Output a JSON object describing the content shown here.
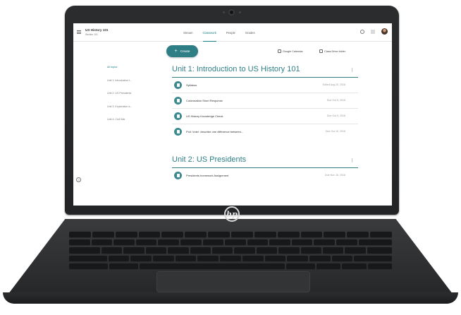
{
  "header": {
    "class_title": "US History 101",
    "class_subtitle": "Section 101",
    "tabs": [
      {
        "label": "Stream"
      },
      {
        "label": "Classwork",
        "active": true
      },
      {
        "label": "People"
      },
      {
        "label": "Grades"
      }
    ]
  },
  "toolbar": {
    "create_label": "Create",
    "calendar_label": "Google Calendar",
    "drive_label": "Class Drive folder"
  },
  "sidebar": {
    "items": [
      {
        "label": "All topics",
        "active": true
      },
      {
        "label": "Unit 1: Introduction t..."
      },
      {
        "label": "Unit 2: US Presidents"
      },
      {
        "label": "Unit 3: Exploration a..."
      },
      {
        "label": "Unit 4: Civil War"
      }
    ]
  },
  "units": [
    {
      "title": "Unit 1: Introduction to US History 101",
      "items": [
        {
          "title": "Syllabus",
          "date": "Edited Aug 20, 2018"
        },
        {
          "title": "Colonization Short Response",
          "date": "Due Oct 5, 2018"
        },
        {
          "title": "US History Knowledge Check",
          "date": "Due Oct 9, 2018"
        },
        {
          "title": "Poll: Vote!: describe one difference between...",
          "date": "Due Oct 10, 2018"
        }
      ]
    },
    {
      "title": "Unit 2: US Presidents",
      "items": [
        {
          "title": "Presidents homework Assignment",
          "date": "Due Nov 16, 2018"
        }
      ]
    }
  ],
  "hardware": {
    "brand_logo": "hp"
  },
  "colors": {
    "accent": "#2e7f85",
    "laptop_body": "#2b2c2e"
  },
  "icons": {
    "menu": "hamburger-menu-icon",
    "settings": "gear-icon",
    "apps": "apps-grid-icon",
    "calendar": "calendar-icon",
    "drive": "folder-icon",
    "assignment": "assignment-icon",
    "help": "help-icon"
  }
}
